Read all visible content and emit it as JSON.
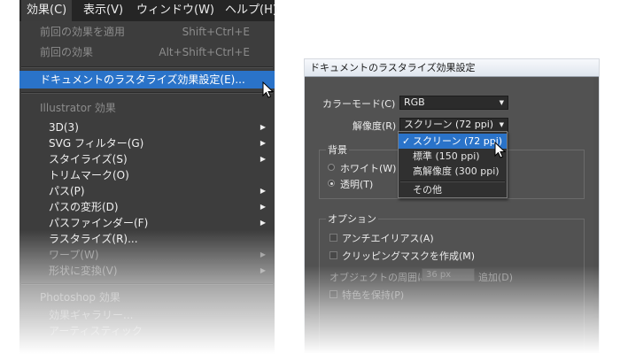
{
  "menubar": {
    "items": [
      "効果(C)",
      "表示(V)",
      "ウィンドウ(W)",
      "ヘルプ(H)"
    ]
  },
  "menu": {
    "apply_last": {
      "label": "前回の効果を適用",
      "shortcut": "Shift+Ctrl+E"
    },
    "last_effect": {
      "label": "前回の効果",
      "shortcut": "Alt+Shift+Ctrl+E"
    },
    "doc_raster": {
      "label": "ドキュメントのラスタライズ効果設定(E)..."
    },
    "illustrator_header": "Illustrator 効果",
    "illustrator_items": [
      {
        "label": "3D(3)",
        "submenu": true,
        "enabled": true
      },
      {
        "label": "SVG フィルター(G)",
        "submenu": true,
        "enabled": true
      },
      {
        "label": "スタイライズ(S)",
        "submenu": true,
        "enabled": true
      },
      {
        "label": "トリムマーク(O)",
        "submenu": false,
        "enabled": true
      },
      {
        "label": "パス(P)",
        "submenu": true,
        "enabled": true
      },
      {
        "label": "パスの変形(D)",
        "submenu": true,
        "enabled": true
      },
      {
        "label": "パスファインダー(F)",
        "submenu": true,
        "enabled": true
      },
      {
        "label": "ラスタライズ(R)...",
        "submenu": false,
        "enabled": true
      },
      {
        "label": "ワープ(W)",
        "submenu": true,
        "enabled": false
      },
      {
        "label": "形状に変換(V)",
        "submenu": true,
        "enabled": false
      }
    ],
    "photoshop_header": "Photoshop 効果",
    "photoshop_items": [
      {
        "label": "効果ギャラリー..."
      },
      {
        "label": "アーティスティック"
      }
    ]
  },
  "dialog": {
    "title": "ドキュメントのラスタライズ効果設定",
    "color_mode": {
      "label": "カラーモード(C) :",
      "value": "RGB"
    },
    "resolution": {
      "label": "解像度(R) :",
      "value": "スクリーン (72 ppi)"
    },
    "background": {
      "label": "背景",
      "white": "ホワイト(W)",
      "transparent": "透明(T)",
      "selected": "transparent"
    },
    "options": {
      "label": "オプション",
      "antialias": "アンチエイリアス(A)",
      "clipping_mask": "クリッピングマスクを作成(M)",
      "around_label": "オブジェクトの周囲に",
      "around_value": "36 px",
      "add_label": "追加(D)",
      "preserve_spot": "特色を保持(P)"
    },
    "resolution_popup": {
      "items": [
        "スクリーン (72 ppi)",
        "標準 (150 ppi)",
        "高解像度 (300 ppi)",
        "その他"
      ],
      "checked_index": 0
    }
  },
  "colors": {
    "highlight": "#2a73c9",
    "menu_bg": "#3d3d3d",
    "dialog_bg": "#525252"
  }
}
